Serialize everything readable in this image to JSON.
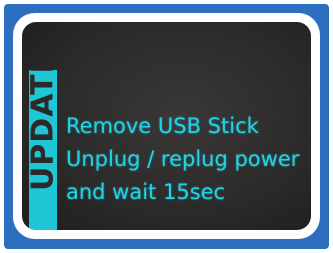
{
  "display": {
    "side_tab_label": "UPDATE",
    "message_lines": [
      "Remove USB Stick",
      "Unplug / replug power",
      "and wait 15sec"
    ]
  },
  "colors": {
    "frame_blue": "#2b6fbe",
    "bezel": "#ffffff",
    "screen_background": "#2b2a29",
    "text_cyan": "#22d3e6",
    "tab_cyan": "#1fc6d6"
  }
}
